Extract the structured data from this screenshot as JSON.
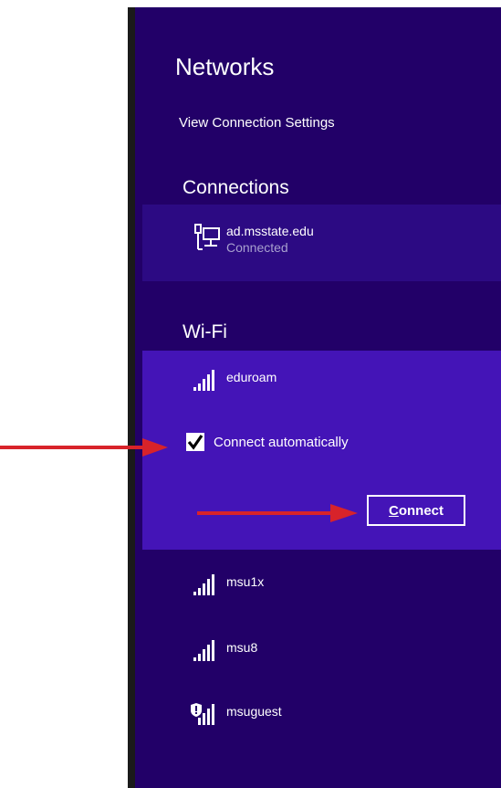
{
  "panel": {
    "title": "Networks",
    "settings_link": "View Connection Settings",
    "connections_heading": "Connections",
    "wifi_heading": "Wi-Fi"
  },
  "connections": [
    {
      "name": "ad.msstate.edu",
      "status": "Connected",
      "icon": "ethernet-icon"
    }
  ],
  "wifi": {
    "selected": {
      "name": "eduroam",
      "icon": "wifi-signal-icon",
      "auto_label": "Connect automatically",
      "auto_checked": true,
      "connect_first_letter": "C",
      "connect_rest": "onnect"
    },
    "others": [
      {
        "name": "msu1x",
        "icon": "wifi-signal-icon"
      },
      {
        "name": "msu8",
        "icon": "wifi-signal-icon"
      },
      {
        "name": "msuguest",
        "icon": "wifi-shield-signal-icon"
      }
    ]
  },
  "colors": {
    "panel_bg": "#220068",
    "connection_highlight": "#2c0a83",
    "selected_network_bg": "#4414b7",
    "annotation_arrow": "#d8232a"
  }
}
